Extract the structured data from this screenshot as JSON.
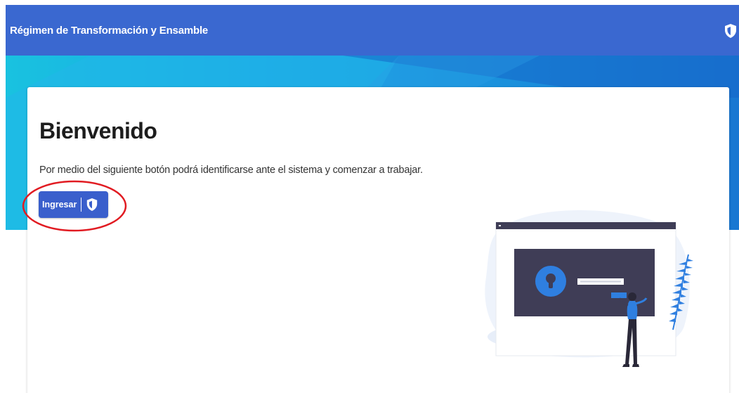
{
  "header": {
    "title": "Régimen de Transformación y Ensamble",
    "icon": "shield-icon"
  },
  "welcome": {
    "title": "Bienvenido",
    "description": "Por medio del siguiente botón podrá identificarse ante el sistema y comenzar a trabajar.",
    "login_button_label": "Ingresar",
    "login_button_icon": "shield-icon"
  },
  "colors": {
    "header_blue": "#3a68d0",
    "banner_cyan": "#1ec3e3",
    "banner_blue": "#1a7fd6",
    "button_blue": "#3a5fcc",
    "highlight_red": "#e11b22",
    "illustration_dark": "#3f3d56",
    "illustration_accent": "#2f7fe0"
  }
}
